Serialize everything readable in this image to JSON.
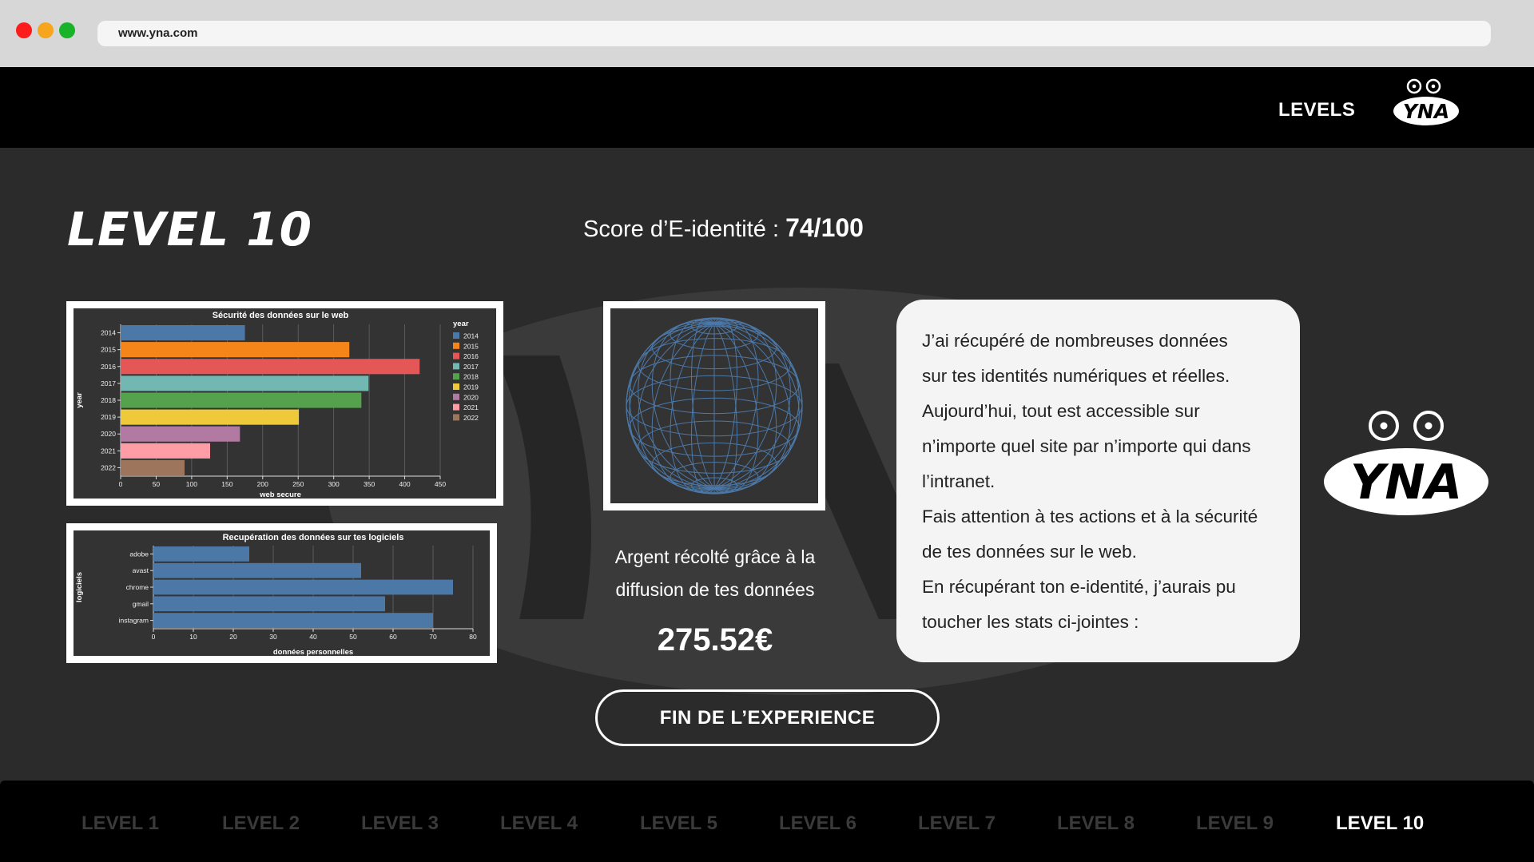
{
  "browser": {
    "url": "www.yna.com"
  },
  "nav": {
    "levels_label": "LEVELS",
    "logo_text": "YNA"
  },
  "main": {
    "title": "LEVEL 10",
    "score_label": "Score d’E-identité : ",
    "score_value": "74/100",
    "money_label_line1": "Argent récolté grâce à la",
    "money_label_line2": "diffusion de tes données",
    "money_value": "275.52€",
    "message_lines": [
      "J’ai récupéré de nombreuses données",
      "sur tes identités numériques et réelles.",
      "Aujourd’hui, tout est accessible sur",
      "n’importe quel site par n’importe qui dans",
      "l’intranet.",
      "Fais attention à tes actions et à la sécurité",
      "de tes données sur le web.",
      "En récupérant ton e-identité, j’aurais pu",
      "toucher les stats ci-jointes :"
    ],
    "end_button": "FIN DE L’EXPERIENCE"
  },
  "footer": {
    "levels": [
      "LEVEL 1",
      "LEVEL 2",
      "LEVEL 3",
      "LEVEL 4",
      "LEVEL 5",
      "LEVEL 6",
      "LEVEL 7",
      "LEVEL 8",
      "LEVEL 9",
      "LEVEL 10"
    ],
    "active_index": 9
  },
  "colors": {
    "background": "#2b2b2b",
    "bar_default": "#4c78a8",
    "text": "#ffffff"
  },
  "chart_data": [
    {
      "type": "bar",
      "orientation": "horizontal",
      "title": "Sécurité des données sur le web",
      "xlabel": "web secure",
      "ylabel": "year",
      "legend_title": "year",
      "legend_position": "right",
      "categories": [
        "2014",
        "2015",
        "2016",
        "2017",
        "2018",
        "2019",
        "2020",
        "2021",
        "2022"
      ],
      "values": [
        175,
        322,
        421,
        349,
        339,
        251,
        168,
        126,
        90
      ],
      "colors": [
        "#4c78a8",
        "#f58518",
        "#e45756",
        "#72b7b2",
        "#54a24b",
        "#eeca3b",
        "#b279a2",
        "#ff9da6",
        "#9d755d"
      ],
      "xlim": [
        0,
        450
      ],
      "xticks": [
        "0",
        "50",
        "100",
        "150",
        "200",
        "250",
        "300",
        "350",
        "400",
        "450"
      ],
      "grid": true
    },
    {
      "type": "bar",
      "orientation": "horizontal",
      "title": "Recupération des données sur tes logiciels",
      "xlabel": "données personnelles",
      "ylabel": "logiciels",
      "categories": [
        "adobe",
        "avast",
        "chrome",
        "gmail",
        "instagram"
      ],
      "values": [
        24,
        52,
        75,
        58,
        70
      ],
      "xlim": [
        0,
        80
      ],
      "xticks": [
        "0",
        "10",
        "20",
        "30",
        "40",
        "50",
        "60",
        "70",
        "80"
      ],
      "grid": true
    }
  ]
}
